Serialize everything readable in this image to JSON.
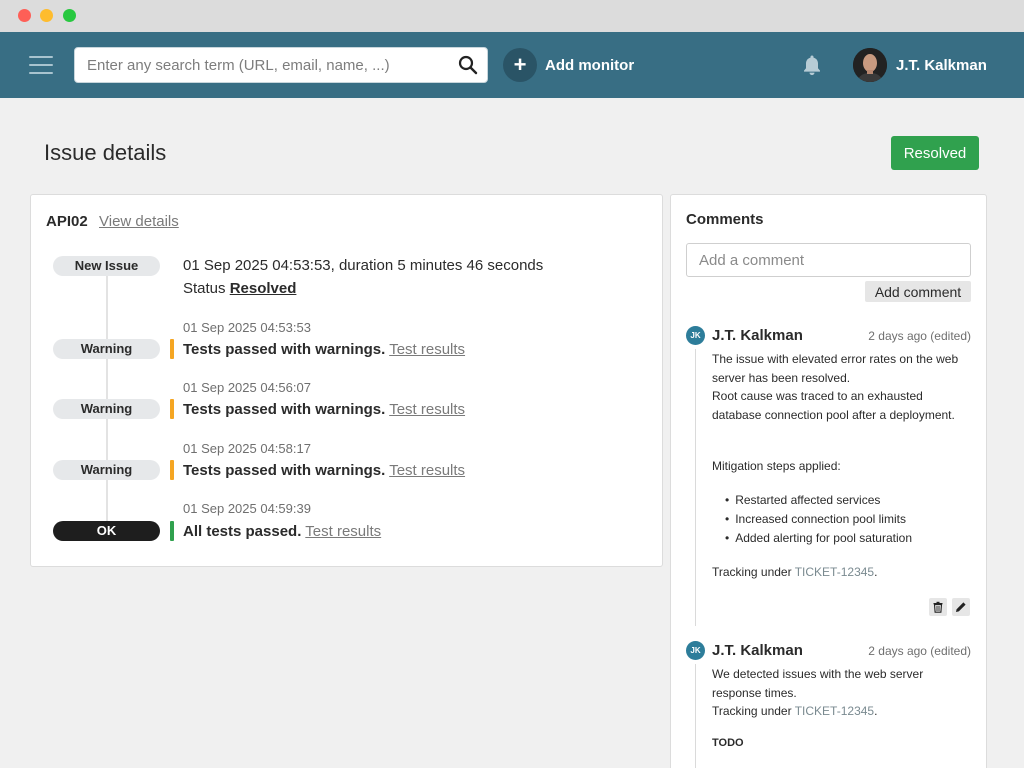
{
  "header": {
    "search_placeholder": "Enter any search term (URL, email, name, ...)",
    "add_monitor_label": "Add monitor",
    "add_monitor_icon": "+",
    "user_name": "J.T. Kalkman"
  },
  "page": {
    "title": "Issue details",
    "status_button": "Resolved"
  },
  "issue": {
    "monitor_name": "API02",
    "view_details_label": "View details",
    "events": [
      {
        "badge": "New Issue",
        "text": "01 Sep 2025 04:53:53, duration 5 minutes 46 seconds",
        "status_prefix": "Status",
        "status_value": "Resolved"
      },
      {
        "badge": "Warning",
        "time": "01 Sep 2025 04:53:53",
        "message": "Tests passed with warnings.",
        "link": "Test results"
      },
      {
        "badge": "Warning",
        "time": "01 Sep 2025 04:56:07",
        "message": "Tests passed with warnings.",
        "link": "Test results"
      },
      {
        "badge": "Warning",
        "time": "01 Sep 2025 04:58:17",
        "message": "Tests passed with warnings.",
        "link": "Test results"
      },
      {
        "badge": "OK",
        "time": "01 Sep 2025 04:59:39",
        "message": "All tests passed.",
        "link": "Test results"
      }
    ]
  },
  "comments": {
    "title": "Comments",
    "input_placeholder": "Add a comment",
    "add_button": "Add comment",
    "items": [
      {
        "initials": "JK",
        "author": "J.T. Kalkman",
        "time": "2 days ago (edited)",
        "p1": "The issue with elevated error rates on the web server has been resolved.",
        "p2": "Root cause was traced to an exhausted database connection pool after a deployment.",
        "p3": "Mitigation steps applied:",
        "bullets": [
          "Restarted affected services",
          "Increased connection pool limits",
          "Added alerting for pool saturation"
        ],
        "tracking_prefix": "Tracking under",
        "ticket": "TICKET-12345",
        "tracking_suffix": "."
      },
      {
        "initials": "JK",
        "author": "J.T. Kalkman",
        "time": "2 days ago (edited)",
        "p1": "We detected issues with the web server response times.",
        "tracking_prefix": "Tracking under",
        "ticket": "TICKET-12345",
        "tracking_suffix": ".",
        "heading": "TODO"
      }
    ]
  },
  "colors": {
    "header_bg": "#386e84",
    "resolved_green": "#30a14e",
    "warning_orange": "#f5a623",
    "ok_badge": "#1e1e1e",
    "avatar_blue": "#2d7d9a"
  },
  "icons": {
    "menu": "hamburger-icon",
    "search": "search-icon",
    "add": "plus-icon",
    "notifications": "bell-icon",
    "delete": "trash-icon",
    "edit": "pencil-icon"
  }
}
